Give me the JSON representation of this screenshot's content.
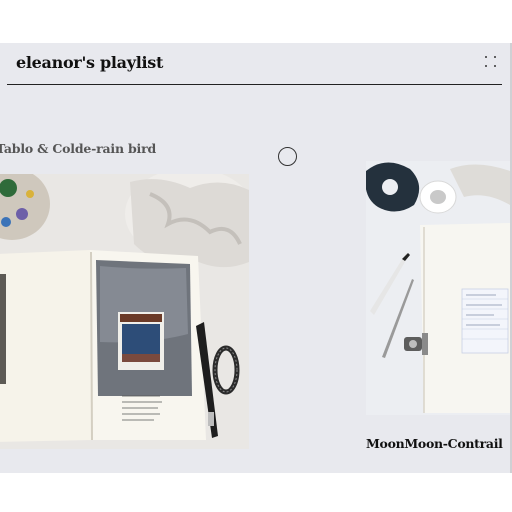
{
  "header": {
    "title": "eleanor's playlist"
  },
  "cards": [
    {
      "caption": "Tablo & Colde-rain bird"
    },
    {
      "caption": "MoonMoon-Contrail"
    }
  ],
  "icons": {
    "menu": "dots-grid-icon",
    "play": "circle-icon"
  }
}
